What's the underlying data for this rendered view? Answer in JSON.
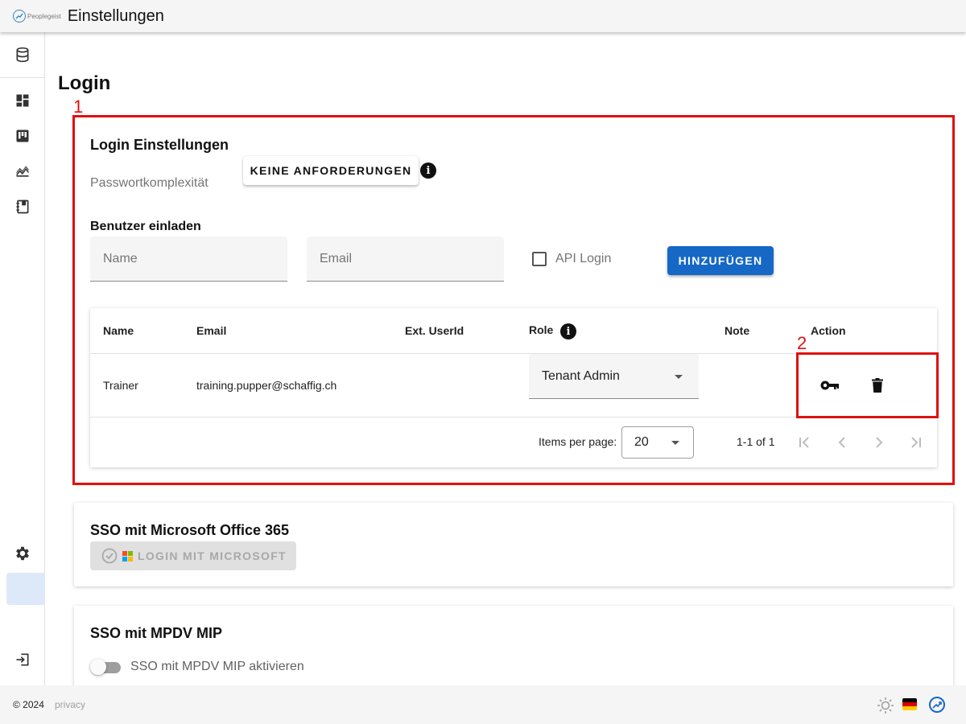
{
  "app": {
    "brand": "Peoplegeist",
    "title": "Einstellungen"
  },
  "sidebar": {
    "items": [
      {
        "icon": "database-icon"
      },
      {
        "icon": "dashboard-icon"
      },
      {
        "icon": "board-icon"
      },
      {
        "icon": "chart-icon"
      },
      {
        "icon": "notebook-icon"
      },
      {
        "icon": "gear-icon"
      },
      {
        "icon": "logout-icon"
      }
    ]
  },
  "main": {
    "section_title": "Login",
    "login_settings": {
      "title": "Login Einstellungen",
      "password_label": "Passwortkomplexität",
      "password_value": "KEINE ANFORDERUNGEN",
      "invite": {
        "title": "Benutzer einladen",
        "name_placeholder": "Name",
        "email_placeholder": "Email",
        "api_login_label": "API Login",
        "add_button": "HINZUFÜGEN"
      },
      "table": {
        "columns": [
          "Name",
          "Email",
          "Ext. UserId",
          "Role",
          "Note",
          "Action"
        ],
        "rows": [
          {
            "name": "Trainer",
            "email": "training.pupper@schaffig.ch",
            "ext_user_id": "",
            "role": "Tenant Admin",
            "note": ""
          }
        ],
        "pagination": {
          "items_per_page_label": "Items per page:",
          "items_per_page": "20",
          "range": "1-1 of 1"
        }
      }
    },
    "sso_microsoft": {
      "title": "SSO mit Microsoft Office 365",
      "button": "LOGIN MIT MICROSOFT"
    },
    "sso_mpdv": {
      "title": "SSO mit MPDV MIP",
      "toggle_label": "SSO mit MPDV MIP aktivieren",
      "enabled": false
    }
  },
  "annotations": [
    "1",
    "2"
  ],
  "footer": {
    "copyright": "© 2024",
    "privacy": "privacy"
  },
  "colors": {
    "primary": "#1668c7",
    "annotation": "#e01010",
    "active_nav": "#dde9f8"
  }
}
